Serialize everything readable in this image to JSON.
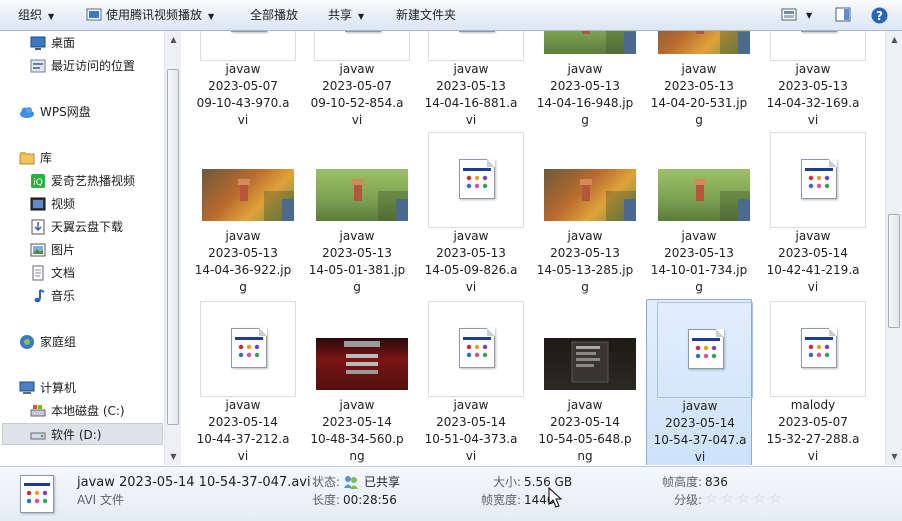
{
  "toolbar": {
    "organize": "组织",
    "play_with": "使用腾讯视频播放",
    "play_all": "全部播放",
    "share": "共享",
    "new_folder": "新建文件夹"
  },
  "nav": {
    "items": [
      {
        "label": "桌面",
        "icon": "desktop-icon"
      },
      {
        "label": "最近访问的位置",
        "icon": "recent-places-icon"
      },
      {
        "label": "WPS网盘",
        "icon": "cloud-icon"
      },
      {
        "label": "库",
        "icon": "library-icon"
      },
      {
        "label": "爱奇艺热播视频",
        "icon": "iqiyi-icon"
      },
      {
        "label": "视频",
        "icon": "video-icon"
      },
      {
        "label": "天翼云盘下载",
        "icon": "download-icon"
      },
      {
        "label": "图片",
        "icon": "pictures-icon"
      },
      {
        "label": "文档",
        "icon": "documents-icon"
      },
      {
        "label": "音乐",
        "icon": "music-icon"
      },
      {
        "label": "家庭组",
        "icon": "homegroup-icon"
      },
      {
        "label": "计算机",
        "icon": "computer-icon"
      },
      {
        "label": "本地磁盘 (C:)",
        "icon": "drive-c-icon"
      },
      {
        "label": "软件 (D:)",
        "icon": "drive-d-icon"
      }
    ]
  },
  "files": [
    {
      "l1": "javaw",
      "l2": "2023-05-07",
      "l3": "09-10-43-970.a",
      "l4": "vi",
      "type": "avi"
    },
    {
      "l1": "javaw",
      "l2": "2023-05-07",
      "l3": "09-10-52-854.a",
      "l4": "vi",
      "type": "avi"
    },
    {
      "l1": "javaw",
      "l2": "2023-05-13",
      "l3": "14-04-16-881.a",
      "l4": "vi",
      "type": "avi"
    },
    {
      "l1": "javaw",
      "l2": "2023-05-13",
      "l3": "14-04-16-948.jp",
      "l4": "g",
      "type": "jpg-green"
    },
    {
      "l1": "javaw",
      "l2": "2023-05-13",
      "l3": "14-04-20-531.jp",
      "l4": "g",
      "type": "jpg-orange"
    },
    {
      "l1": "javaw",
      "l2": "2023-05-13",
      "l3": "14-04-32-169.a",
      "l4": "vi",
      "type": "avi"
    },
    {
      "l1": "javaw",
      "l2": "2023-05-13",
      "l3": "14-04-36-922.jp",
      "l4": "g",
      "type": "jpg-orange"
    },
    {
      "l1": "javaw",
      "l2": "2023-05-13",
      "l3": "14-05-01-381.jp",
      "l4": "g",
      "type": "jpg-green"
    },
    {
      "l1": "javaw",
      "l2": "2023-05-13",
      "l3": "14-05-09-826.a",
      "l4": "vi",
      "type": "avi"
    },
    {
      "l1": "javaw",
      "l2": "2023-05-13",
      "l3": "14-05-13-285.jp",
      "l4": "g",
      "type": "jpg-orange"
    },
    {
      "l1": "javaw",
      "l2": "2023-05-13",
      "l3": "14-10-01-734.jp",
      "l4": "g",
      "type": "jpg-green"
    },
    {
      "l1": "javaw",
      "l2": "2023-05-14",
      "l3": "10-42-41-219.a",
      "l4": "vi",
      "type": "avi"
    },
    {
      "l1": "javaw",
      "l2": "2023-05-14",
      "l3": "10-44-37-212.a",
      "l4": "vi",
      "type": "avi"
    },
    {
      "l1": "javaw",
      "l2": "2023-05-14",
      "l3": "10-48-34-560.p",
      "l4": "ng",
      "type": "png-red"
    },
    {
      "l1": "javaw",
      "l2": "2023-05-14",
      "l3": "10-51-04-373.a",
      "l4": "vi",
      "type": "avi"
    },
    {
      "l1": "javaw",
      "l2": "2023-05-14",
      "l3": "10-54-05-648.p",
      "l4": "ng",
      "type": "png-dark"
    },
    {
      "l1": "javaw",
      "l2": "2023-05-14",
      "l3": "10-54-37-047.a",
      "l4": "vi",
      "type": "avi"
    },
    {
      "l1": "malody",
      "l2": "2023-05-07",
      "l3": "15-32-27-288.a",
      "l4": "vi",
      "type": "avi"
    }
  ],
  "selected_index": 16,
  "details": {
    "filename": "javaw 2023-05-14 10-54-37-047.avi",
    "filetype": "AVI 文件",
    "status_key": "状态:",
    "status_val": "已共享",
    "length_key": "长度:",
    "length_val": "00:28:56",
    "size_key": "大小:",
    "size_val": "5.56 GB",
    "width_key": "帧宽度:",
    "width_val": "1440",
    "height_key": "帧高度:",
    "height_val": "836",
    "rating_key": "分级:",
    "rating_stars": 0
  },
  "colors": {
    "accent": "#1a3d99",
    "selection": "#cde2fa"
  }
}
